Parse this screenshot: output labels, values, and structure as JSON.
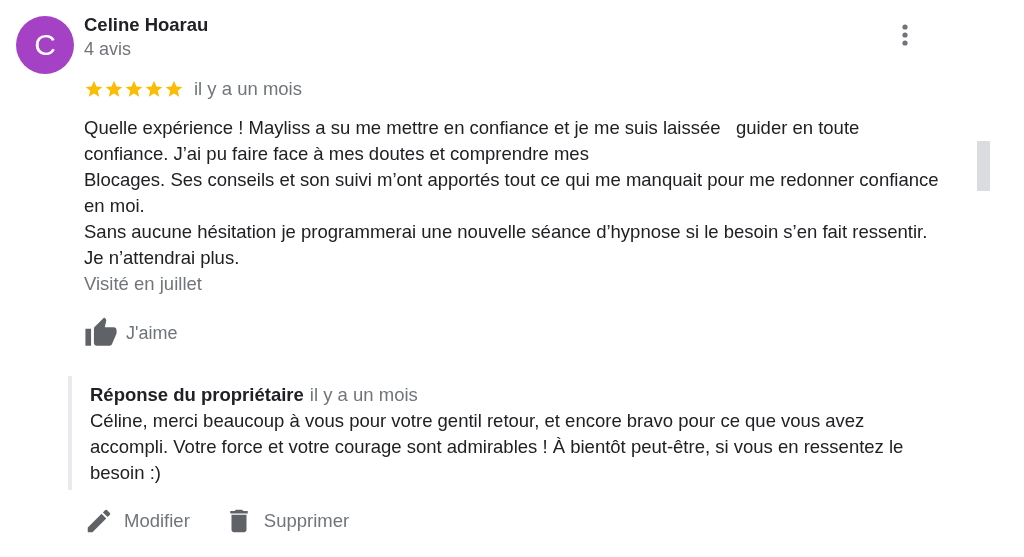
{
  "review": {
    "author": "Celine Hoarau",
    "avatar_letter": "C",
    "review_count": "4 avis",
    "stars": 5,
    "date": "il y a un mois",
    "text": "Quelle expérience ! Mayliss a su me mettre en confiance et je me suis laissée   guider en toute\nconfiance. J’ai pu faire face à mes doutes et comprendre mes\nBlocages. Ses conseils et son suivi m’ont apportés tout ce qui me manquait pour me redonner confiance\nen moi.\nSans aucune hésitation je programmerai une nouvelle séance d’hypnose si le besoin s’en fait ressentir.\nJe n’attendrai plus.",
    "visited": "Visité en juillet",
    "like_label": "J'aime"
  },
  "owner_reply": {
    "title": "Réponse du propriétaire",
    "date": "il y a un mois",
    "text": "Céline, merci beaucoup à vous pour votre gentil retour, et encore bravo pour ce que vous avez\naccompli. Votre force et votre courage sont admirables ! À bientôt peut-être, si vous en ressentez le\nbesoin :)"
  },
  "actions": [
    {
      "kind": "edit",
      "label": "Modifier"
    },
    {
      "kind": "delete",
      "label": "Supprimer"
    }
  ]
}
